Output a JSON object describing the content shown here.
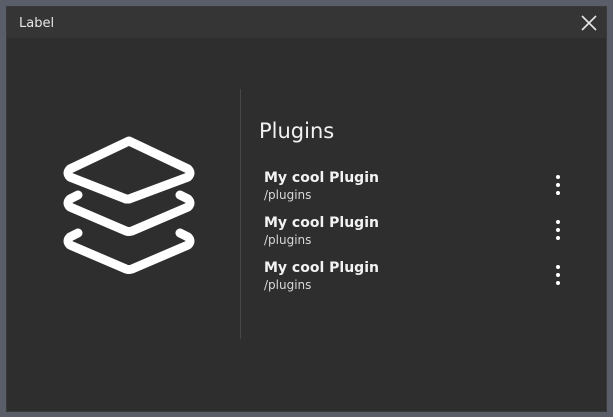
{
  "window": {
    "title": "Label"
  },
  "main": {
    "section_title": "Plugins",
    "icon": "stack-layers-icon",
    "plugins": [
      {
        "name": "My cool Plugin",
        "path": "/plugins"
      },
      {
        "name": "My cool Plugin",
        "path": "/plugins"
      },
      {
        "name": "My cool Plugin",
        "path": "/plugins"
      }
    ]
  },
  "colors": {
    "window_bg": "#2e2e2e",
    "titlebar_bg": "#353535",
    "outer_bg": "#5a5e69",
    "text": "#f2f2f2",
    "divider": "#474747"
  }
}
